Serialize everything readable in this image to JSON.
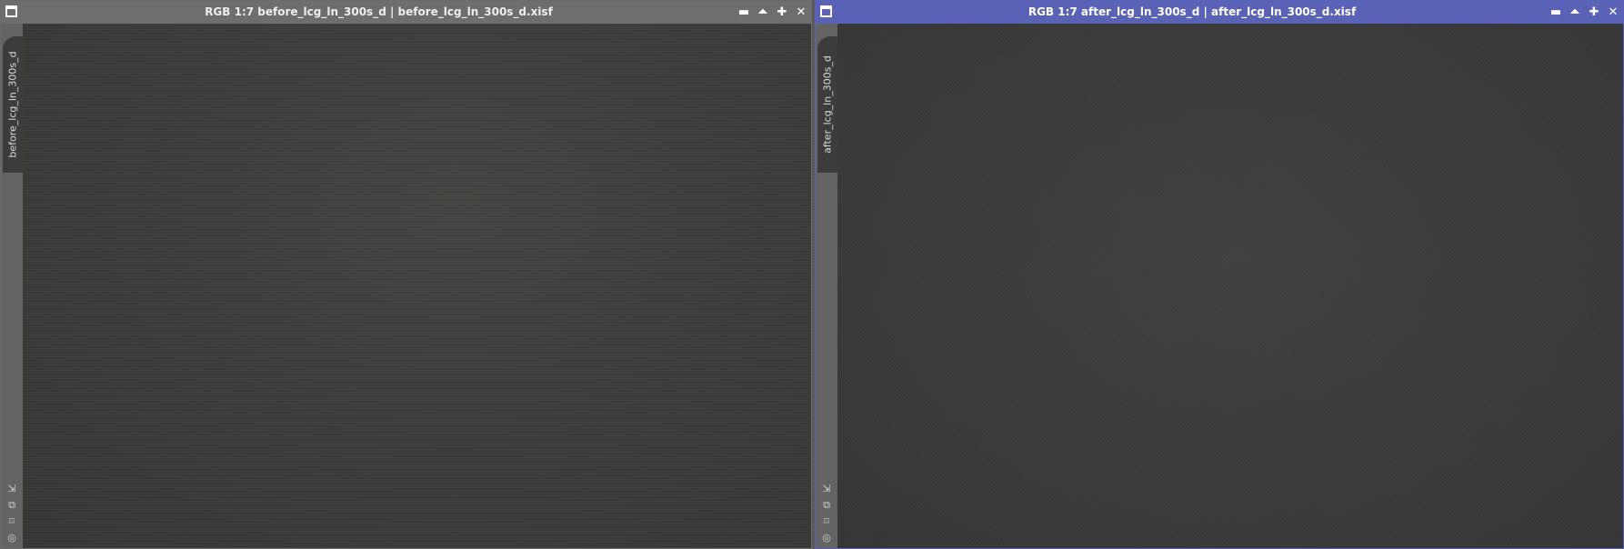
{
  "windows": [
    {
      "title": "RGB 1:7 before_lcg_ln_300s_d | before_lcg_ln_300s_d.xisf",
      "tab_label": "before_lcg_ln_300s_d",
      "active": false,
      "controls": {
        "minimize": "▬",
        "shade": "⏶",
        "maximize": "✚",
        "close": "✕"
      },
      "sidebar_icons": {
        "fit": "⇲",
        "clone": "⧉",
        "zoom": "⌑",
        "mask": "◎"
      }
    },
    {
      "title": "RGB 1:7 after_lcg_ln_300s_d | after_lcg_ln_300s_d.xisf",
      "tab_label": "after_lcg_ln_300s_d",
      "active": true,
      "controls": {
        "minimize": "▬",
        "shade": "⏶",
        "maximize": "✚",
        "close": "✕"
      },
      "sidebar_icons": {
        "fit": "⇲",
        "clone": "⧉",
        "zoom": "⌑",
        "mask": "◎"
      }
    }
  ],
  "colors": {
    "active_titlebar": "#5962b4",
    "inactive_titlebar": "#6e6e6e",
    "workspace": "#5a5a5a"
  }
}
